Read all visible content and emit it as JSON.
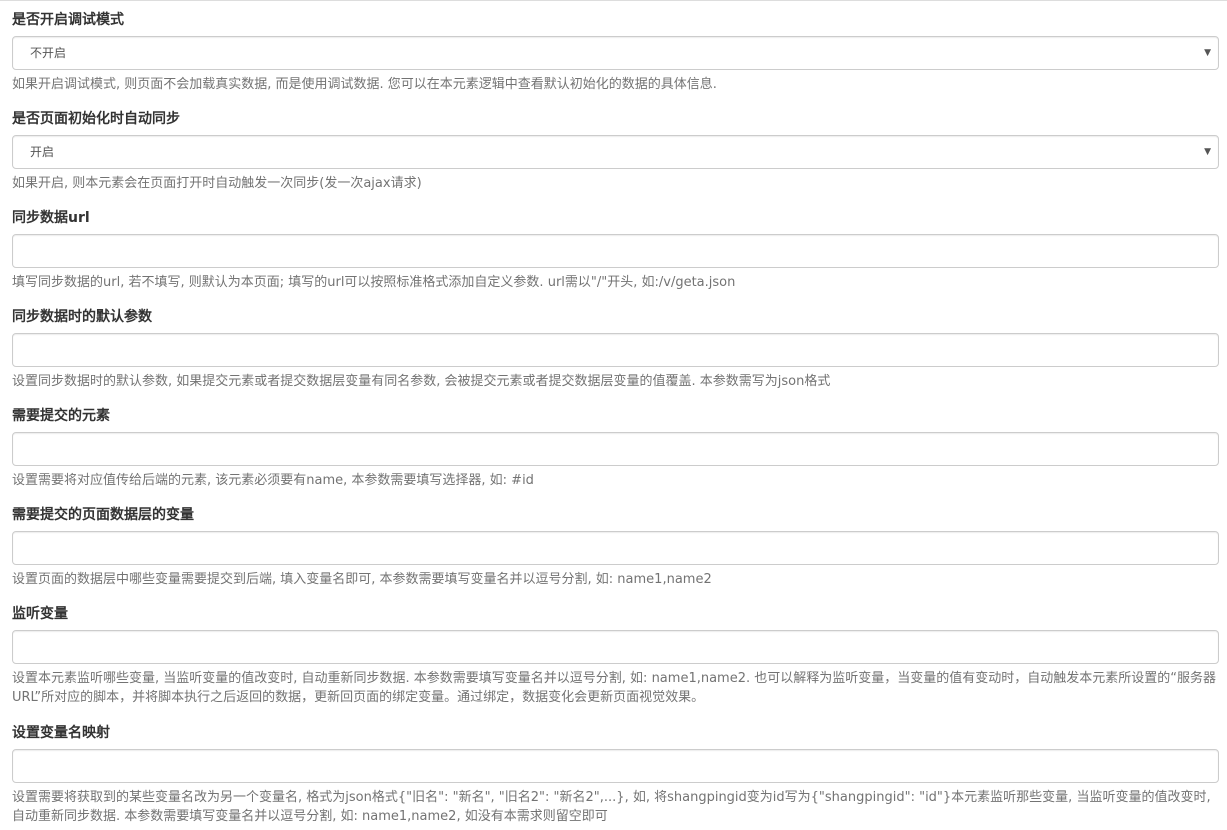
{
  "fields": [
    {
      "label": "是否开启调试模式",
      "type": "select",
      "value": "不开启",
      "help": "如果开启调试模式, 则页面不会加载真实数据, 而是使用调试数据. 您可以在本元素逻辑中查看默认初始化的数据的具体信息."
    },
    {
      "label": "是否页面初始化时自动同步",
      "type": "select",
      "value": "开启",
      "help": "如果开启, 则本元素会在页面打开时自动触发一次同步(发一次ajax请求)"
    },
    {
      "label": "同步数据url",
      "type": "input",
      "value": "",
      "help": "填写同步数据的url, 若不填写, 则默认为本页面; 填写的url可以按照标准格式添加自定义参数. url需以\"/\"开头, 如:/v/geta.json"
    },
    {
      "label": "同步数据时的默认参数",
      "type": "input",
      "value": "",
      "help": "设置同步数据时的默认参数, 如果提交元素或者提交数据层变量有同名参数, 会被提交元素或者提交数据层变量的值覆盖. 本参数需写为json格式"
    },
    {
      "label": "需要提交的元素",
      "type": "input",
      "value": "",
      "help": "设置需要将对应值传给后端的元素, 该元素必须要有name, 本参数需要填写选择器, 如: #id"
    },
    {
      "label": "需要提交的页面数据层的变量",
      "type": "input",
      "value": "",
      "help": "设置页面的数据层中哪些变量需要提交到后端, 填入变量名即可, 本参数需要填写变量名并以逗号分割, 如: name1,name2"
    },
    {
      "label": "监听变量",
      "type": "input",
      "value": "",
      "help": "设置本元素监听哪些变量, 当监听变量的值改变时, 自动重新同步数据. 本参数需要填写变量名并以逗号分割, 如: name1,name2. 也可以解释为监听变量，当变量的值有变动时，自动触发本元素所设置的“服务器URL”所对应的脚本，并将脚本执行之后返回的数据，更新回页面的绑定变量。通过绑定，数据变化会更新页面视觉效果。"
    },
    {
      "label": "设置变量名映射",
      "type": "input",
      "value": "",
      "help": "设置需要将获取到的某些变量名改为另一个变量名, 格式为json格式{\"旧名\": \"新名\", \"旧名2\": \"新名2\",...}, 如, 将shangpingid变为id写为{\"shangpingid\": \"id\"}本元素监听那些变量, 当监听变量的值改变时, 自动重新同步数据. 本参数需要填写变量名并以逗号分割, 如: name1,name2, 如没有本需求则留空即可"
    }
  ]
}
